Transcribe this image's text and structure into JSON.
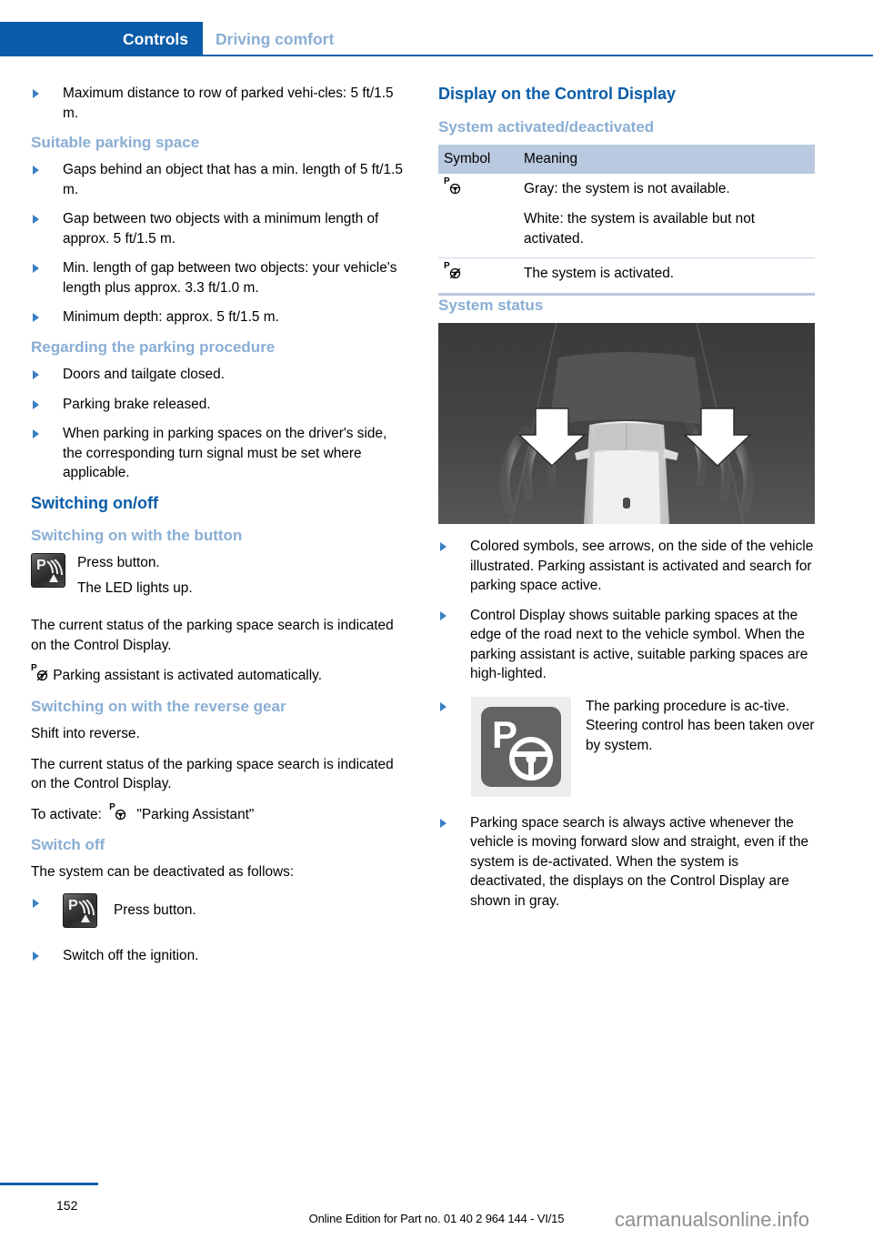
{
  "header": {
    "active_tab": "Controls",
    "inactive_tab": "Driving comfort",
    "active_bg": "#0a5ca8",
    "inactive_color": "#8aaed4"
  },
  "left_column": {
    "first_bullet": "Maximum distance to row of parked vehi-cles: 5 ft/1.5 m.",
    "suitable_parking_space": {
      "heading": "Suitable parking space",
      "bullets": [
        "Gaps behind an object that has a min. length of 5 ft/1.5 m.",
        "Gap between two objects with a minimum length of approx. 5 ft/1.5 m.",
        "Min. length of gap between two objects: your vehicle's length plus approx. 3.3 ft/1.0 m.",
        "Minimum depth: approx. 5 ft/1.5 m."
      ]
    },
    "regarding_procedure": {
      "heading": "Regarding the parking procedure",
      "bullets": [
        "Doors and tailgate closed.",
        "Parking brake released.",
        "When parking in parking spaces on the driver's side, the corresponding turn signal must be set where applicable."
      ]
    },
    "switching_on_off": {
      "heading": "Switching on/off"
    },
    "switching_on_button": {
      "heading": "Switching on with the button",
      "press_button": "Press button.",
      "led": "The LED lights up.",
      "status_text": "The current status of the parking space search is indicated on the Control Display.",
      "auto_activated": "Parking assistant is activated automatically."
    },
    "switching_on_reverse": {
      "heading": "Switching on with the reverse gear",
      "shift": "Shift into reverse.",
      "status_text": "The current status of the parking space search is indicated on the Control Display.",
      "to_activate_prefix": "To activate:",
      "to_activate_value": "\"Parking Assistant\""
    },
    "switch_off": {
      "heading": "Switch off",
      "intro": "The system can be deactivated as follows:",
      "press_button": "Press button.",
      "ignition": "Switch off the ignition."
    }
  },
  "right_column": {
    "display_heading": "Display on the Control Display",
    "system_activated": {
      "heading": "System activated/deactivated",
      "table": {
        "columns": [
          "Symbol",
          "Meaning"
        ],
        "rows": [
          {
            "symbol": "p-steering-wheel-upright",
            "meaning": [
              "Gray: the system is not available.",
              "White: the system is available but not activated."
            ]
          },
          {
            "symbol": "p-steering-wheel-tilted",
            "meaning": [
              "The system is activated."
            ]
          }
        ]
      }
    },
    "system_status": {
      "heading": "System status",
      "illustration": "top-down-vehicle-with-parking-space-arrows",
      "bullets": [
        "Colored symbols, see arrows, on the side of the vehicle illustrated. Parking assistant is activated and search for parking space active.",
        "Control Display shows suitable parking spaces at the edge of the road next to the vehicle symbol. When the parking assistant is active, suitable parking spaces are high-lighted."
      ],
      "tile_bullet": "The parking procedure is ac-tive. Steering control has been taken over by system.",
      "last_bullet": "Parking space search is always active whenever the vehicle is moving forward slow and straight, even if the system is de-activated. When the system is deactivated, the displays on the Control Display are shown in gray."
    }
  },
  "footer": {
    "page_number": "152",
    "edition_text": "Online Edition for Part no. 01 40 2 964 144 - VI/15",
    "watermark": "carmanualsonline.info"
  }
}
